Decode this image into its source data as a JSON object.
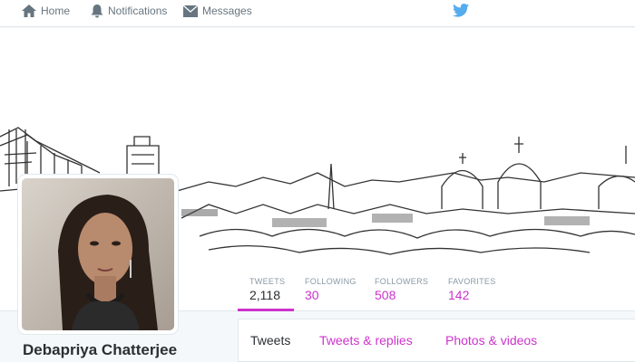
{
  "topnav": {
    "home_label": "Home",
    "notifications_label": "Notifications",
    "messages_label": "Messages",
    "brand_icon": "twitter-bird-icon"
  },
  "profile": {
    "name": "Debapriya Chatterjee",
    "accent_color": "#cc33cc"
  },
  "stats": [
    {
      "label": "TWEETS",
      "value": "2,118",
      "active": true
    },
    {
      "label": "FOLLOWING",
      "value": "30"
    },
    {
      "label": "FOLLOWERS",
      "value": "508"
    },
    {
      "label": "FAVORITES",
      "value": "142"
    }
  ],
  "tabs": [
    {
      "label": "Tweets",
      "active": true
    },
    {
      "label": "Tweets & replies"
    },
    {
      "label": "Photos & videos"
    }
  ]
}
